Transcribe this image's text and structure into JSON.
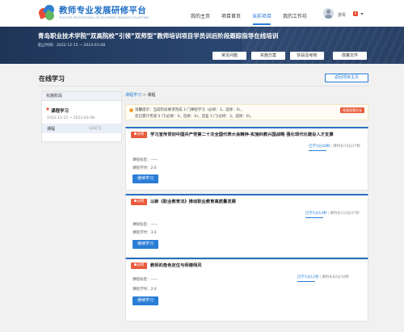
{
  "header": {
    "logo_title": "教师专业发展研修平台",
    "logo_subtitle": "TEACHER PROFESSIONAL DEVELOPMENT RESEARCH PLATFORM",
    "nav": [
      "我的主页",
      "项目首页",
      "当前项目",
      "我的工作坊"
    ],
    "active_nav": "当前项目",
    "user_name": "游青",
    "badge_count": "0",
    "accent_color": "#2a7dd6"
  },
  "banner": {
    "title": "青岛职业技术学院“双高院校”引领“双师型”教师培训项目学员训后阶段跟踪指导在线培训",
    "time_label": "起止时间：2022-12-15 ~ 2023-03-08",
    "buttons": [
      "常见问题",
      "实施方案",
      "阶段及考核",
      "政策文件"
    ]
  },
  "page": {
    "title": "在线学习",
    "back_button": "返回项目主页"
  },
  "sidebar": {
    "header": "实施阶段",
    "stage_name": "课程学习",
    "stage_date": "2022-12-15 ~ 2023-03-08",
    "item_label": "课程",
    "item_count": "(3/3门)"
  },
  "breadcrumb": {
    "root": "课程学习",
    "sep": ">",
    "current": "课程"
  },
  "notice": {
    "line1": "温馨提示：当前阶段要求完成 3 门课程学习（必修：3，选修：0）。",
    "line2": "您已累计完成 0 门(必修：0，选修：0)，还差 3 门(必修：3，选修：0)。",
    "link": "视频观看时长"
  },
  "courses": [
    {
      "tag": "必修",
      "title": "学习宣传贯彻中国共产党第二十次全国代表大会精神-实施科教兴国战略 强化现代化建设人才支撑",
      "progress_done": "已学3分28秒",
      "progress_total": "课时长70分27秒",
      "progress_fraction": 0.049,
      "target_label": "课程标签：——",
      "credit_label": "课程学时：2.0",
      "button": "继续学习"
    },
    {
      "tag": "必修",
      "title": "以新《职业教育法》推动职业教育高质量发展",
      "progress_done": "已学1分14秒",
      "progress_total": "课时长114分27秒",
      "progress_fraction": 0.011,
      "target_label": "课程标签：——",
      "credit_label": "课程学时：3.0",
      "button": "继续学习"
    },
    {
      "tag": "必修",
      "title": "教师的角色定位与师德师风",
      "progress_done": "已学1分11秒",
      "progress_total": "课时长82分16秒",
      "progress_fraction": 0.014,
      "target_label": "课程标签：——",
      "credit_label": "课程学时：2.0",
      "button": "继续学习"
    }
  ]
}
